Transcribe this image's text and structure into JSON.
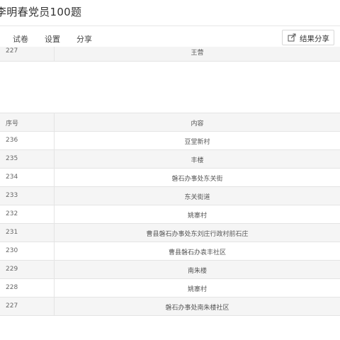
{
  "header": {
    "title": "李明春党员100题"
  },
  "nav": {
    "tabs": [
      "试卷",
      "设置",
      "分享"
    ]
  },
  "share_button": {
    "label": "结果分享"
  },
  "previous_table": {
    "last_row": {
      "num": "227",
      "text": "王营"
    }
  },
  "table": {
    "columns": [
      "序号",
      "内容"
    ],
    "rows": [
      {
        "num": "236",
        "text": "豆堂新村"
      },
      {
        "num": "235",
        "text": "丰楼"
      },
      {
        "num": "234",
        "text": "磐石办事处东关街"
      },
      {
        "num": "233",
        "text": "东关街道"
      },
      {
        "num": "232",
        "text": "姚寨村"
      },
      {
        "num": "231",
        "text": "曹县磐石办事处东刘庄行政村前石庄"
      },
      {
        "num": "230",
        "text": "曹县磐石办袁丰社区"
      },
      {
        "num": "229",
        "text": "南朱楼"
      },
      {
        "num": "228",
        "text": "姚寨村"
      },
      {
        "num": "227",
        "text": "磐石办事处南朱楼社区"
      }
    ]
  }
}
